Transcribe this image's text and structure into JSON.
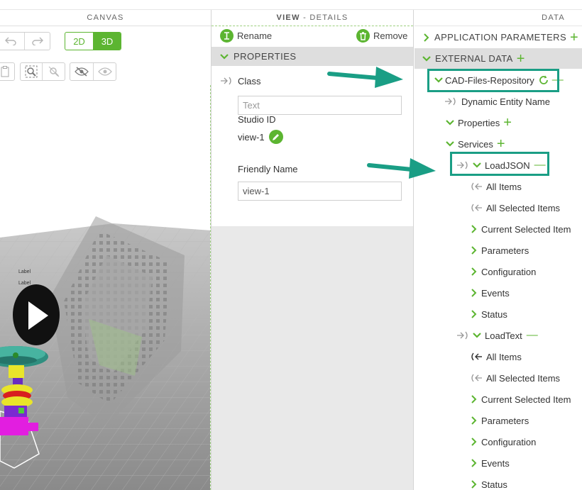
{
  "canvas": {
    "title": "CANVAS",
    "mode_2d": "2D",
    "mode_3d": "3D",
    "scene_labels": [
      "Label",
      "Label"
    ]
  },
  "details": {
    "title_bold": "VIEW",
    "title_rest": " - DETAILS",
    "rename_label": "Rename",
    "remove_label": "Remove",
    "section_title": "PROPERTIES",
    "class_label": "Class",
    "class_placeholder": "Text",
    "studio_id_label": "Studio ID",
    "studio_id_value": "view-1",
    "friendly_name_label": "Friendly Name",
    "friendly_name_value": "view-1"
  },
  "data": {
    "title": "DATA",
    "app_params": "APPLICATION PARAMETERS",
    "external_data": "EXTERNAL DATA",
    "repository": "CAD-Files-Repository",
    "dynamic_entity": "Dynamic Entity Name",
    "properties": "Properties",
    "services": "Services",
    "load_json": "LoadJSON",
    "load_json_children": [
      "All Items",
      "All Selected Items",
      "Current Selected Item",
      "Parameters",
      "Configuration",
      "Events",
      "Status"
    ],
    "load_text": "LoadText",
    "load_text_children": [
      "All Items",
      "All Selected Items",
      "Current Selected Item",
      "Parameters",
      "Configuration",
      "Events",
      "Status"
    ]
  },
  "colors": {
    "accent_green": "#5cb531",
    "highlight_teal": "#1a9e85"
  }
}
